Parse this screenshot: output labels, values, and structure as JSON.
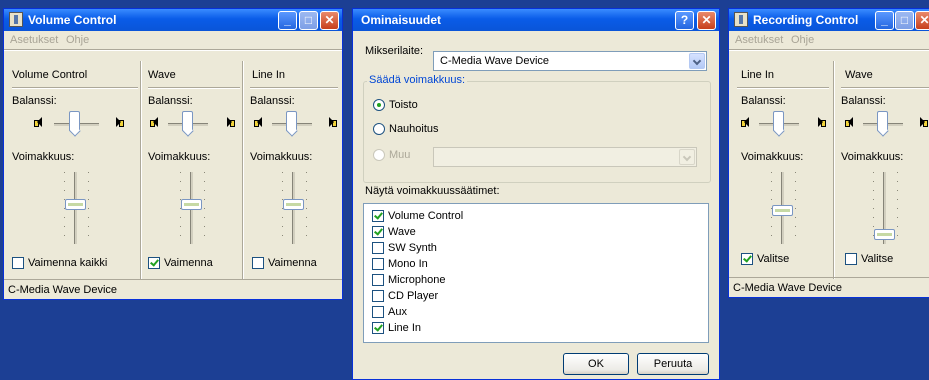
{
  "volume_control": {
    "title": "Volume Control",
    "menu": [
      "Asetukset",
      "Ohje"
    ],
    "columns": [
      {
        "name": "Volume Control",
        "balance_label": "Balanssi:",
        "volume_label": "Voimakkuus:",
        "mute_label": "Vaimenna kaikki",
        "mute_checked": false
      },
      {
        "name": "Wave",
        "balance_label": "Balanssi:",
        "volume_label": "Voimakkuus:",
        "mute_label": "Vaimenna",
        "mute_checked": true
      },
      {
        "name": "Line In",
        "balance_label": "Balanssi:",
        "volume_label": "Voimakkuus:",
        "mute_label": "Vaimenna",
        "mute_checked": false
      }
    ],
    "status": "C-Media Wave Device"
  },
  "properties": {
    "title": "Ominaisuudet",
    "help_button": "?",
    "close_button": "✕",
    "mixer_label": "Mikserilaite:",
    "mixer_value": "C-Media Wave Device",
    "adjust_group": "Säädä voimakkuus:",
    "radio_playback": "Toisto",
    "radio_recording": "Nauhoitus",
    "radio_other": "Muu",
    "show_label": "Näytä voimakkuussäätimet:",
    "items": [
      {
        "label": "Volume Control",
        "checked": true
      },
      {
        "label": "Wave",
        "checked": true
      },
      {
        "label": "SW Synth",
        "checked": false
      },
      {
        "label": "Mono In",
        "checked": false
      },
      {
        "label": "Microphone",
        "checked": false
      },
      {
        "label": "CD Player",
        "checked": false
      },
      {
        "label": "Aux",
        "checked": false
      },
      {
        "label": "Line In",
        "checked": true
      }
    ],
    "ok_label": "OK",
    "cancel_label": "Peruuta"
  },
  "recording_control": {
    "title": "Recording Control",
    "menu": [
      "Asetukset",
      "Ohje"
    ],
    "columns": [
      {
        "name": "Line In",
        "balance_label": "Balanssi:",
        "volume_label": "Voimakkuus:",
        "select_label": "Valitse",
        "select_checked": true
      },
      {
        "name": "Wave",
        "balance_label": "Balanssi:",
        "volume_label": "Voimakkuus:",
        "select_label": "Valitse",
        "select_checked": false
      }
    ],
    "status": "C-Media Wave Device"
  },
  "colors": {
    "desktop": "#1c3f94",
    "titlebar": "#0a5ce8",
    "window": "#ece9d8",
    "check": "#21a121"
  }
}
